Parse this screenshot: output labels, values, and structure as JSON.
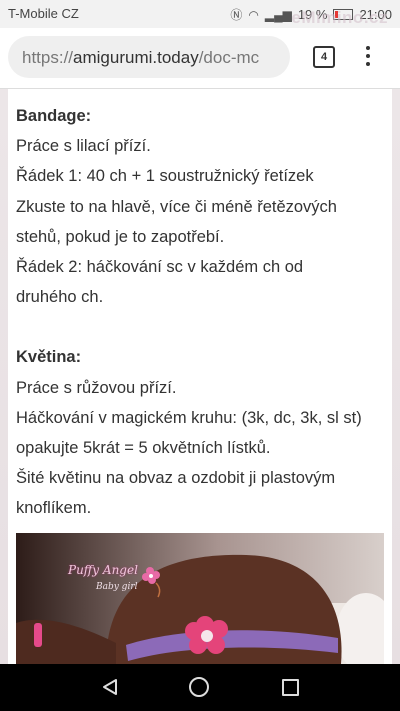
{
  "status_bar": {
    "carrier": "T-Mobile CZ",
    "battery": "19 %",
    "time": "21:00",
    "watermark": "eMimino.cz"
  },
  "browser": {
    "url_scheme": "https://",
    "url_domain": "amigurumi.today",
    "url_path": "/doc-mc",
    "tab_count": "4"
  },
  "article": {
    "section1": {
      "heading": "Bandage:",
      "lines": [
        "Práce s lilací přízí.",
        "Řádek 1: 40 ch + 1 soustružnický řetízek",
        "Zkuste to na hlavě, více či méně řetězových",
        "stehů, pokud je to zapotřebí.",
        "Řádek 2: háčkování sc v každém ch od",
        "druhého ch."
      ]
    },
    "section2": {
      "heading": "Květina:",
      "lines": [
        "Práce s růžovou přízí.",
        "Háčkování v magickém kruhu: (3k, dc, 3k, sl st)",
        "opakujte 5krát = 5 okvětních lístků.",
        "Šité květinu na obvaz a ozdobit ji plastovým",
        "knoflíkem."
      ]
    },
    "photo": {
      "brand": "Puffy Angel",
      "brand_sub": "Baby girl"
    }
  },
  "colors": {
    "text": "#333333",
    "hat_brown": "#5b3224",
    "band_lilac": "#8c6ab8",
    "flower_pink": "#e4447a"
  }
}
